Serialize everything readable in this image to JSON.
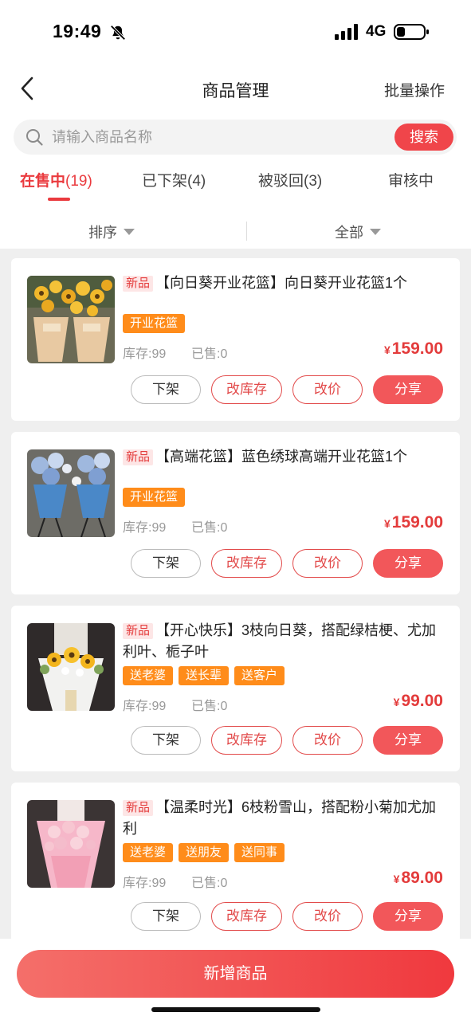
{
  "status_bar": {
    "time": "19:49",
    "network": "4G"
  },
  "nav": {
    "title": "商品管理",
    "batch_label": "批量操作"
  },
  "search": {
    "placeholder": "请输入商品名称",
    "button_label": "搜索"
  },
  "tabs": [
    {
      "label": "在售中",
      "count": "(19)",
      "active": true
    },
    {
      "label": "已下架",
      "count": "(4)",
      "active": false
    },
    {
      "label": "被驳回",
      "count": "(3)",
      "active": false
    },
    {
      "label": "审核中",
      "count": "",
      "active": false
    }
  ],
  "filters": {
    "sort_label": "排序",
    "scope_label": "全部"
  },
  "actions": {
    "off_label": "下架",
    "stock_label": "改库存",
    "price_label": "改价",
    "share_label": "分享"
  },
  "products": [
    {
      "badge": "新品",
      "title": "【向日葵开业花篮】向日葵开业花篮1个",
      "tags": [
        "开业花篮"
      ],
      "stock": "库存:99",
      "sold": "已售:0",
      "currency": "¥",
      "price": "159.00"
    },
    {
      "badge": "新品",
      "title": "【高端花篮】蓝色绣球高端开业花篮1个",
      "tags": [
        "开业花篮"
      ],
      "stock": "库存:99",
      "sold": "已售:0",
      "currency": "¥",
      "price": "159.00"
    },
    {
      "badge": "新品",
      "title": "【开心快乐】3枝向日葵，搭配绿桔梗、尤加利叶、栀子叶",
      "tags": [
        "送老婆",
        "送长辈",
        "送客户"
      ],
      "stock": "库存:99",
      "sold": "已售:0",
      "currency": "¥",
      "price": "99.00"
    },
    {
      "badge": "新品",
      "title": "【温柔时光】6枝粉雪山，搭配粉小菊加尤加利",
      "tags": [
        "送老婆",
        "送朋友",
        "送同事"
      ],
      "stock": "库存:99",
      "sold": "已售:0",
      "currency": "¥",
      "price": "89.00"
    }
  ],
  "bottom": {
    "add_label": "新增商品"
  },
  "colors": {
    "accent": "#ea3a3e",
    "tag": "#ff8c1a",
    "badge_bg": "#fde6e6"
  }
}
